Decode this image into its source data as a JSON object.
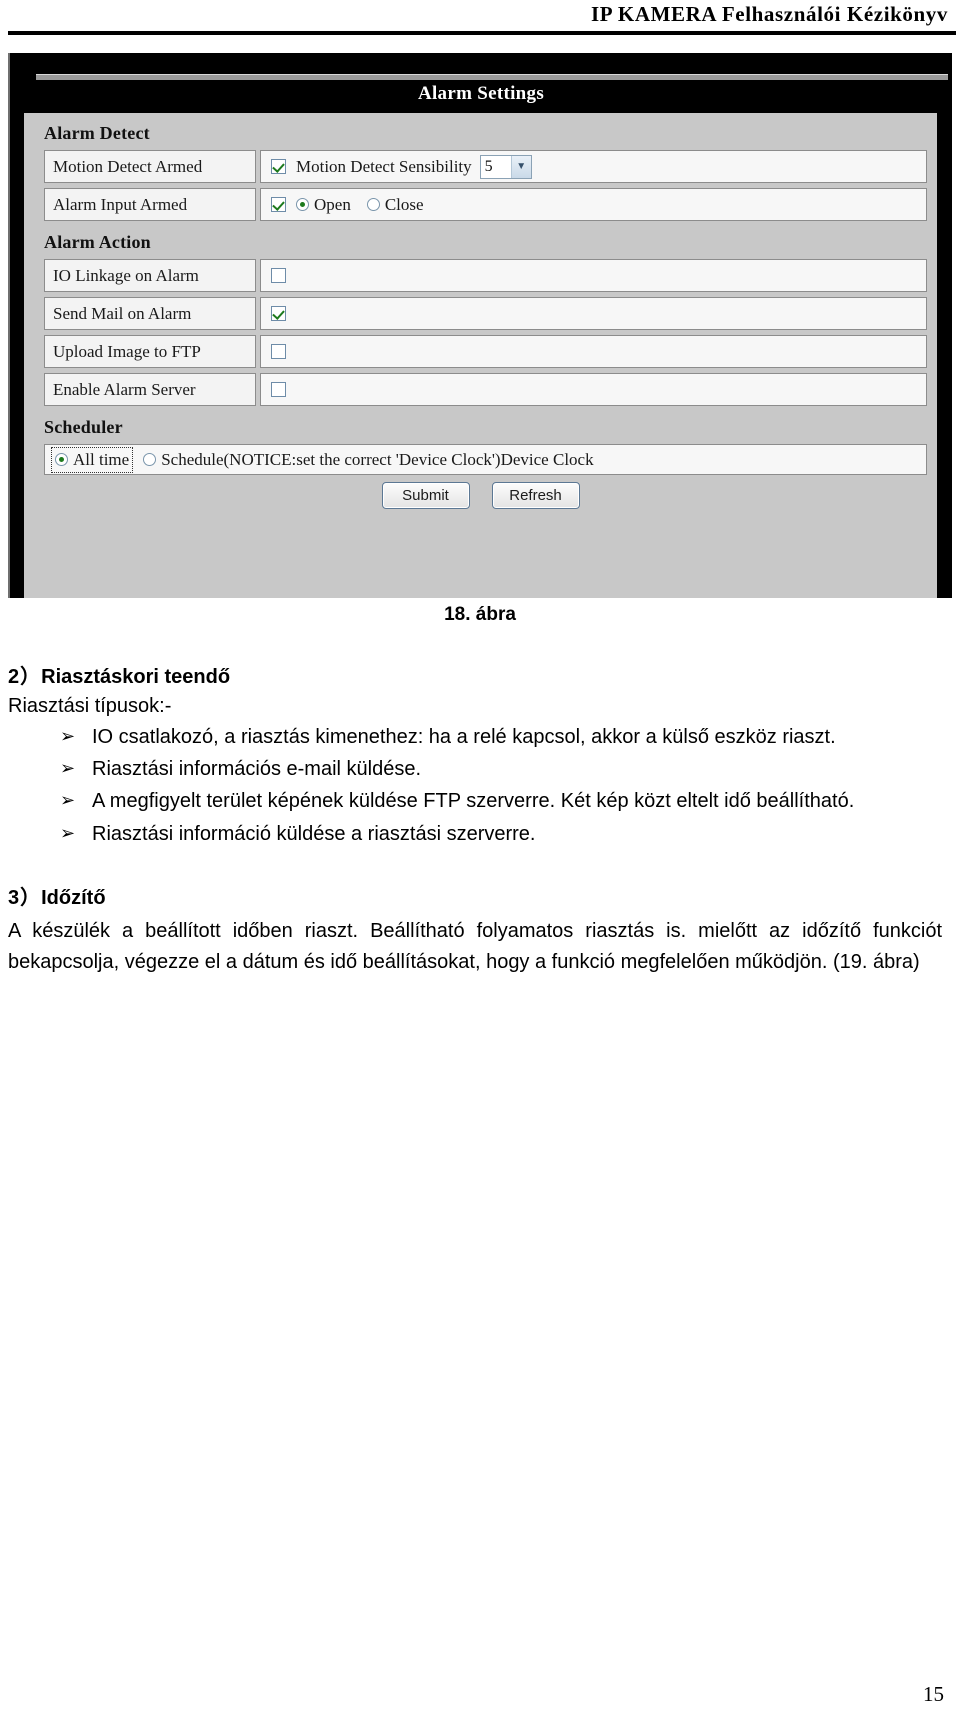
{
  "header": {
    "running_title": "IP KAMERA Felhasználói Kézikönyv"
  },
  "figure": {
    "caption": "18. ábra",
    "screenshot": {
      "window_title": "Alarm Settings",
      "sections": [
        {
          "heading": "Alarm Detect",
          "rows": [
            {
              "label": "Motion Detect Armed",
              "checkbox_checked": true,
              "value_label": "Motion Detect Sensibility",
              "select_value": "5",
              "select_arrow": "▼"
            },
            {
              "label": "Alarm Input Armed",
              "checkbox_checked": true,
              "radios": [
                {
                  "label": "Open",
                  "selected": true
                },
                {
                  "label": "Close",
                  "selected": false
                }
              ]
            }
          ]
        },
        {
          "heading": "Alarm Action",
          "rows": [
            {
              "label": "IO Linkage on Alarm",
              "checkbox_checked": false
            },
            {
              "label": "Send Mail on Alarm",
              "checkbox_checked": true
            },
            {
              "label": "Upload Image to FTP",
              "checkbox_checked": false
            },
            {
              "label": "Enable Alarm Server",
              "checkbox_checked": false
            }
          ]
        },
        {
          "heading": "Scheduler",
          "scheduler": {
            "all_time_label": "All time",
            "all_time_selected": true,
            "schedule_label": "Schedule(NOTICE:set the correct 'Device Clock')Device Clock",
            "schedule_selected": false
          }
        }
      ],
      "buttons": {
        "submit": "Submit",
        "refresh": "Refresh"
      }
    }
  },
  "body": {
    "section2": {
      "number": "2）",
      "title": "Riasztáskori teendő",
      "intro": "Riasztási típusok:-",
      "bullet_glyph": "➢",
      "bullets": [
        "IO csatlakozó, a riasztás kimenethez: ha a relé kapcsol, akkor a külső eszköz riaszt.",
        "Riasztási információs e-mail küldése.",
        "A megfigyelt terület képének küldése FTP szerverre. Két kép közt eltelt idő beállítható.",
        "Riasztási információ küldése a riasztási szerverre."
      ]
    },
    "section3": {
      "number": "3）",
      "title": "Időzítő",
      "paragraph": "A készülék a beállított időben riaszt. Beállítható folyamatos riasztás is. mielőtt az időzítő funkciót bekapcsolja, végezze el a dátum és idő beállításokat, hogy a funkció megfelelően működjön. (19. ábra)"
    }
  },
  "footer": {
    "page_number": "15"
  }
}
